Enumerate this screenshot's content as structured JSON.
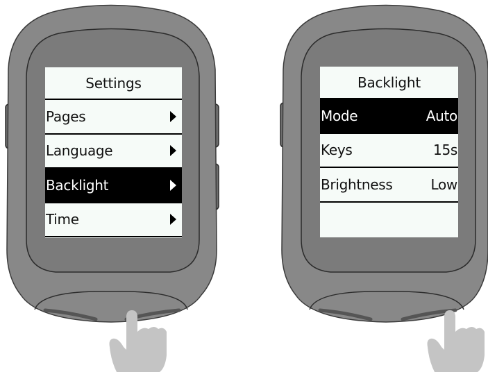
{
  "left_device": {
    "header": "Settings",
    "menu": [
      {
        "label": "Pages",
        "selected": false
      },
      {
        "label": "Language",
        "selected": false
      },
      {
        "label": "Backlight",
        "selected": true
      },
      {
        "label": "Time",
        "selected": false
      }
    ],
    "row_icon": "triangle-right-icon"
  },
  "right_device": {
    "header": "Backlight",
    "settings": [
      {
        "label": "Mode",
        "value": "Auto",
        "selected": true
      },
      {
        "label": "Keys",
        "value": "15s",
        "selected": false
      },
      {
        "label": "Brightness",
        "value": "Low",
        "selected": false
      }
    ]
  },
  "colors": {
    "device_body": "#878787",
    "device_face": "#7e7e7e",
    "device_outline": "#2b2b2b",
    "screen_bg": "#f6fbf8",
    "hand": "#c4c4c4",
    "selection": "#000000"
  },
  "icons": [
    "pointing-hand-icon"
  ]
}
